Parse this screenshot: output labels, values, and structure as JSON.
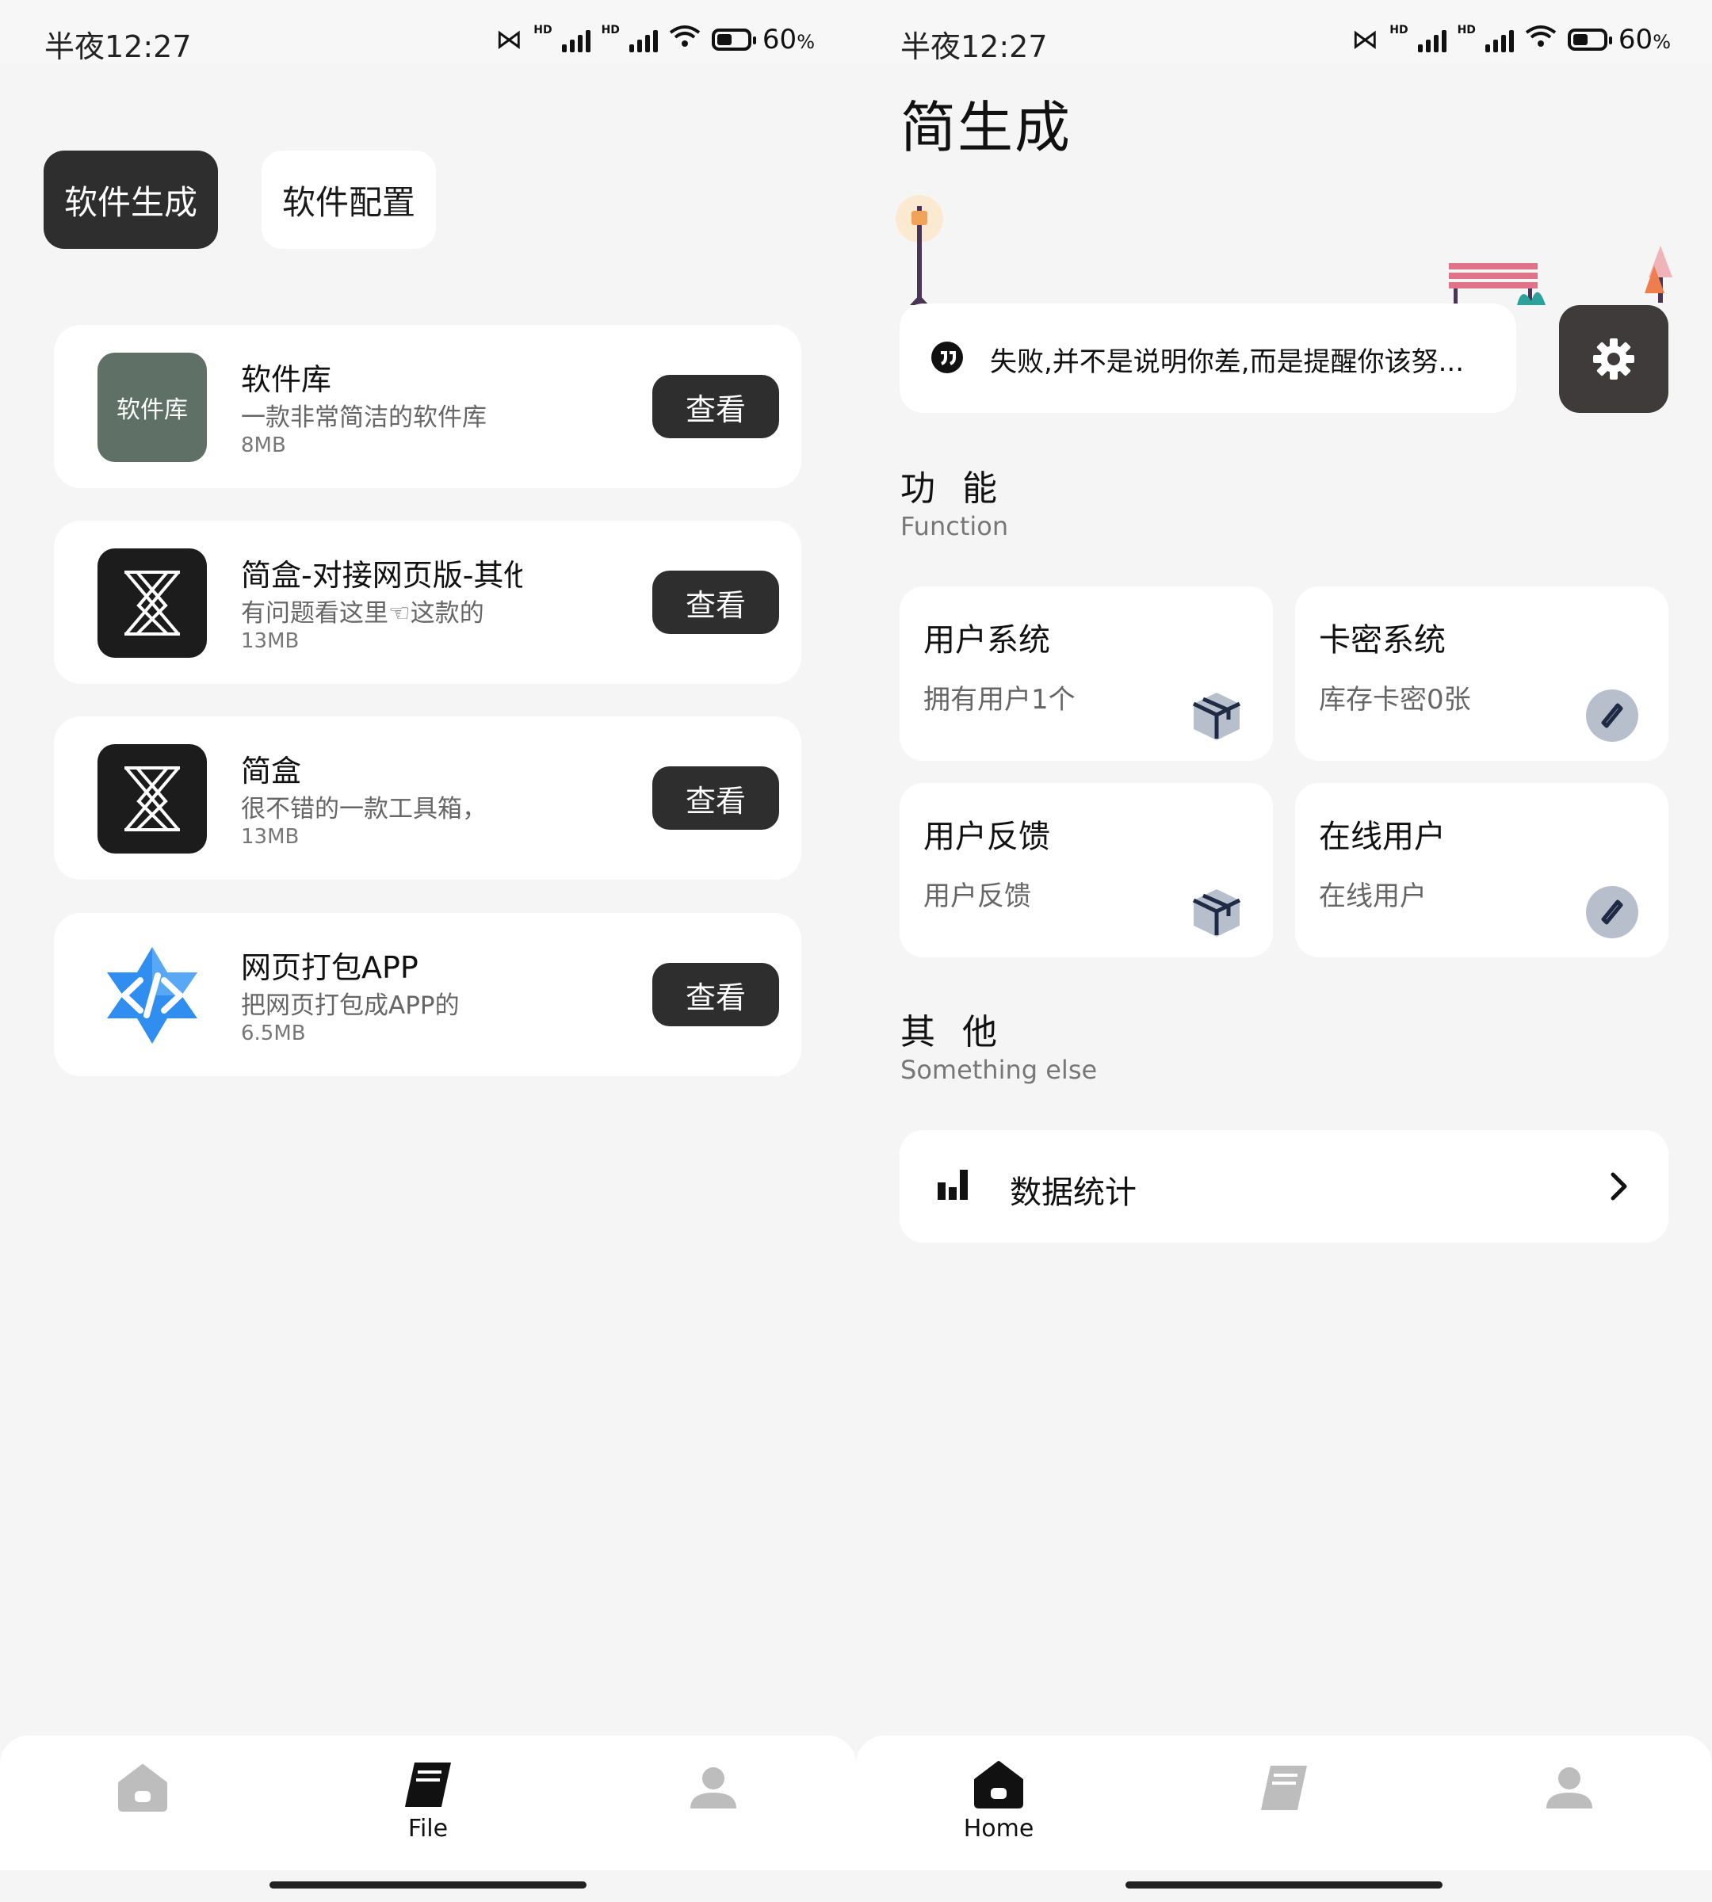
{
  "status_bar": {
    "time": "半夜12:27",
    "hd1": "HD",
    "hd2": "HD",
    "battery_pct": "60",
    "battery_unit": "%"
  },
  "left": {
    "tabs": [
      {
        "label": "软件生成"
      },
      {
        "label": "软件配置"
      }
    ],
    "apps": [
      {
        "name": "软件库",
        "desc": "一款非常简洁的软件库",
        "size": "8MB",
        "icon_text": "软件库",
        "icon_color": "#5f7167",
        "button": "查看"
      },
      {
        "name": "简盒-对接网页版-其他",
        "desc": "有问题看这里☜这款的",
        "size": "13MB",
        "button": "查看"
      },
      {
        "name": "简盒",
        "desc": "很不错的一款工具箱，",
        "size": "13MB",
        "button": "查看"
      },
      {
        "name": "网页打包APP",
        "desc": "把网页打包成APP的",
        "size": "6.5MB",
        "button": "查看"
      }
    ],
    "nav": {
      "file_label": "File"
    }
  },
  "right": {
    "title": "简生成",
    "quote": "失败,并不是说明你差,而是提醒你该努...",
    "section1": {
      "title": "功 能",
      "subtitle": "Function"
    },
    "features": [
      {
        "title": "用户系统",
        "sub": "拥有用户1个",
        "icon": "package-icon"
      },
      {
        "title": "卡密系统",
        "sub": "库存卡密0张",
        "icon": "compass-icon"
      },
      {
        "title": "用户反馈",
        "sub": "用户反馈",
        "icon": "package-icon"
      },
      {
        "title": "在线用户",
        "sub": "在线用户",
        "icon": "compass-icon"
      }
    ],
    "section2": {
      "title": "其 他",
      "subtitle": "Something else"
    },
    "stat_row": {
      "label": "数据统计"
    },
    "nav": {
      "home_label": "Home"
    }
  },
  "colors": {
    "accent_dark": "#2e2e2e",
    "gear_bg": "#3f3b3a",
    "background": "#f5f5f5"
  }
}
